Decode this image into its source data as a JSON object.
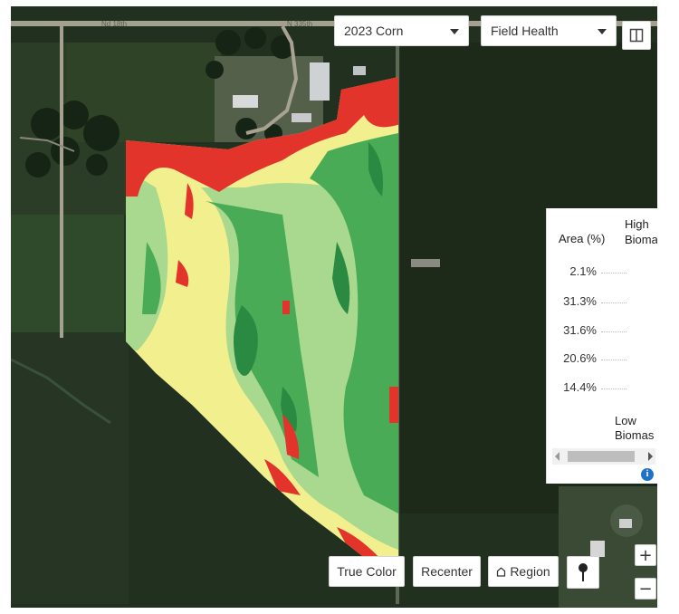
{
  "controls": {
    "season_select": "2023 Corn",
    "layer_select": "Field Health"
  },
  "legend": {
    "area_header": "Area (%)",
    "high_label": "High\nBiomas",
    "low_label": "Low\nBiomas",
    "rows": [
      {
        "value": "2.1%"
      },
      {
        "value": "31.3%"
      },
      {
        "value": "31.6%"
      },
      {
        "value": "20.6%"
      },
      {
        "value": "14.4%"
      }
    ]
  },
  "buttons": {
    "true_color": "True Color",
    "recenter": "Recenter",
    "region": "Region"
  },
  "zoom": {
    "in": "+",
    "out": "−"
  },
  "roads": {
    "north_label_1": "Nd 18th",
    "north_label_2": "N 335th"
  },
  "colors": {
    "high": "#2a8a42",
    "mid_high": "#4aab57",
    "mid": "#a9d98f",
    "low_mid": "#f2ef8f",
    "low": "#e2342a"
  }
}
